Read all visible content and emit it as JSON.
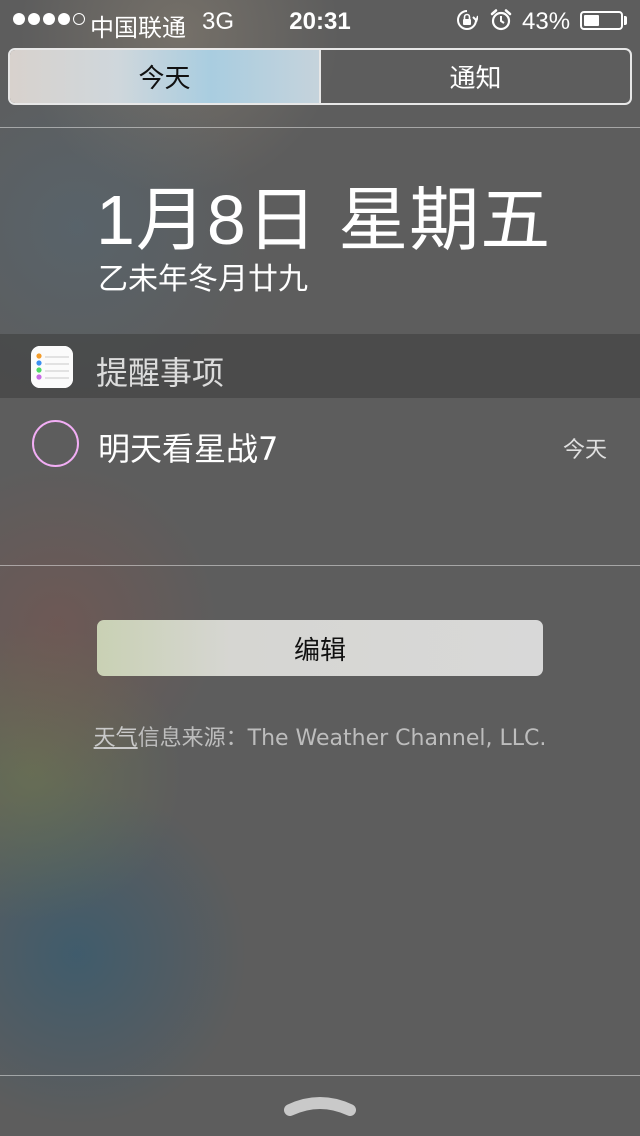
{
  "status_bar": {
    "signal_bars": 5,
    "signal_filled": 4,
    "carrier": "中国联通",
    "network": "3G",
    "time": "20:31",
    "battery_percent": "43%",
    "battery_level": 0.43,
    "icons": [
      "rotation-lock-icon",
      "alarm-icon",
      "battery-icon"
    ]
  },
  "segmented_control": {
    "today": "今天",
    "notifications": "通知",
    "selected": "today"
  },
  "date": {
    "main": "1月8日 星期五",
    "lunar": "乙未年冬月廿九"
  },
  "reminders": {
    "section_title": "提醒事项",
    "icon": "reminders-app-icon",
    "items": [
      {
        "title": "明天看星战7",
        "due": "今天",
        "circle_color": "#f2aef5"
      }
    ]
  },
  "edit_button": {
    "label": "编辑"
  },
  "attribution": {
    "link_text": "天气",
    "text": "信息来源：The Weather Channel, LLC."
  },
  "grabber": {
    "icon": "chevron-up-grabber-icon"
  }
}
